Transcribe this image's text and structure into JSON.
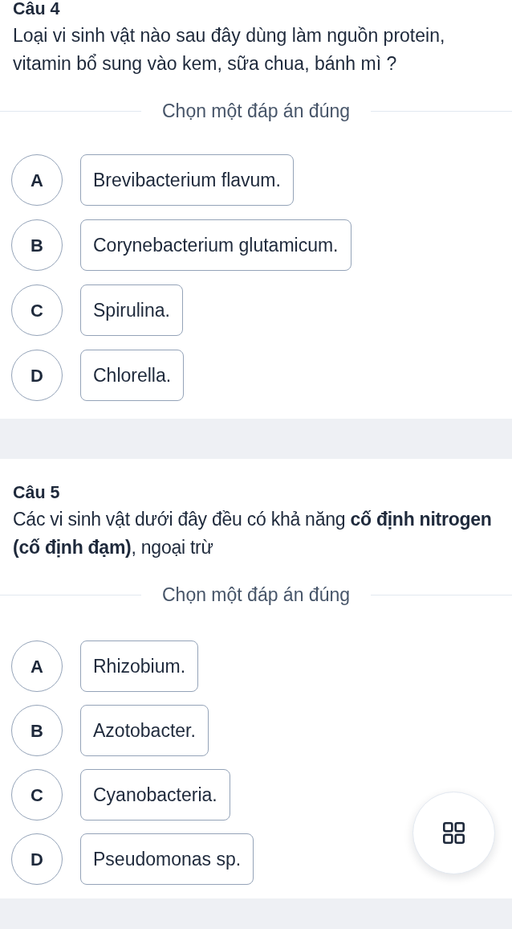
{
  "questions": [
    {
      "title": "Câu 4",
      "text": "Loại vi sinh vật nào sau đây dùng làm nguồn protein, vitamin bổ sung vào kem, sữa chua, bánh mì ?",
      "instruction": "Chọn một đáp án đúng",
      "options": [
        {
          "letter": "A",
          "text": "Brevibacterium flavum.",
          "selected": false
        },
        {
          "letter": "B",
          "text": "Corynebacterium glutamicum.",
          "selected": false
        },
        {
          "letter": "C",
          "text": "Spirulina.",
          "selected": false
        },
        {
          "letter": "D",
          "text": "Chlorella.",
          "selected": false
        }
      ]
    },
    {
      "title": "Câu 5",
      "text": "Các vi sinh vật dưới đây đều có khả năng **cố định nitrogen (cố định đạm)**, ngoại trừ",
      "instruction": "Chọn một đáp án đúng",
      "options": [
        {
          "letter": "A",
          "text": "Rhizobium.",
          "selected": false
        },
        {
          "letter": "B",
          "text": "Azotobacter.",
          "selected": false
        },
        {
          "letter": "C",
          "text": "Cyanobacteria.",
          "selected": false
        },
        {
          "letter": "D",
          "text": "Pseudomonas sp.",
          "selected": false
        }
      ]
    }
  ]
}
